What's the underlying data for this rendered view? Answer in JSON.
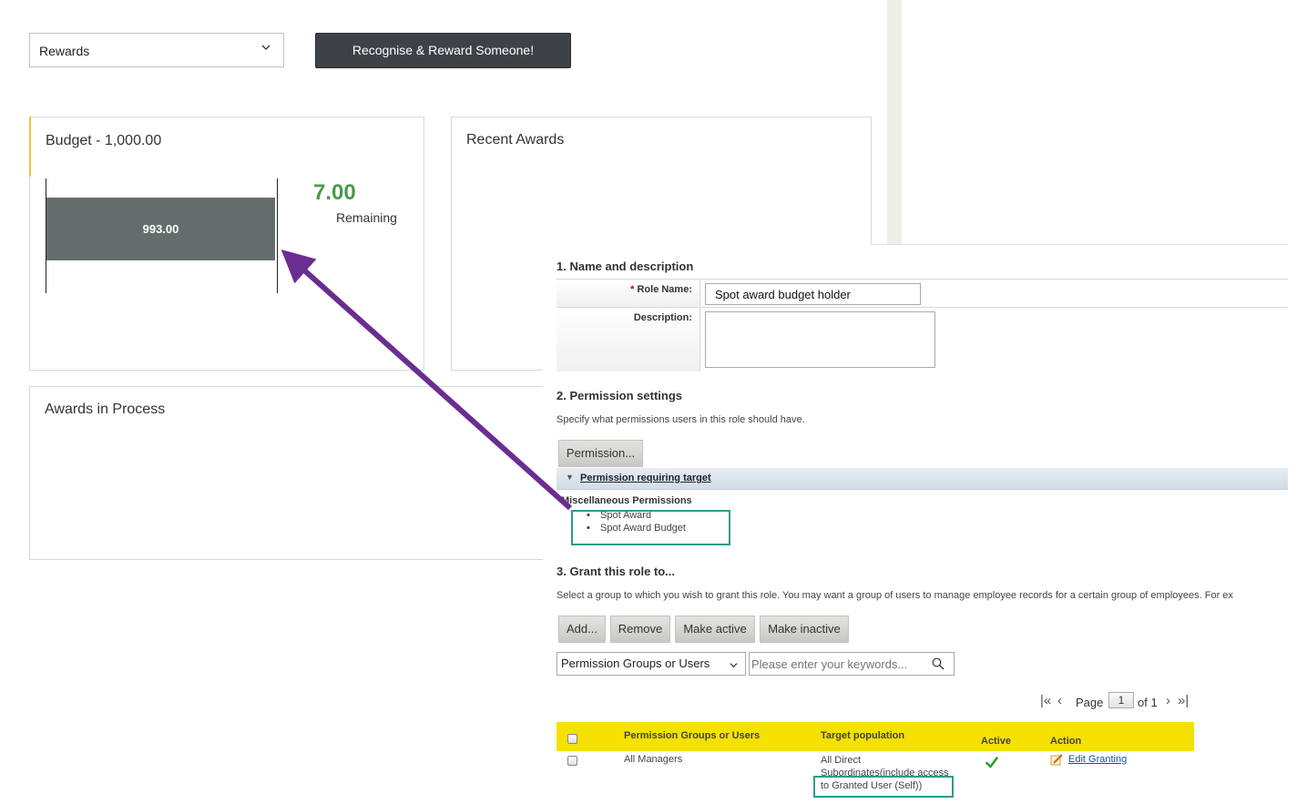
{
  "toolbar": {
    "rewards_select": "Rewards",
    "recognise_button": "Recognise & Reward Someone!"
  },
  "budget": {
    "title": "Budget - 1,000.00",
    "used_value": "993.00",
    "used_fraction": 0.993,
    "remaining_value": "7.00",
    "remaining_label": "Remaining"
  },
  "recent_awards": {
    "title": "Recent Awards"
  },
  "awards_in_process": {
    "title": "Awards in Process"
  },
  "role_form": {
    "section1_title": "1. Name and description",
    "role_name_label": "Role Name:",
    "role_name_value": "Spot award budget holder",
    "description_label": "Description:",
    "description_value": "",
    "section2_title": "2. Permission settings",
    "section2_desc": "Specify what permissions users in this role should have.",
    "permission_button": "Permission...",
    "permission_target_label": "Permission requiring target",
    "misc_title": "Miscellaneous Permissions",
    "permissions": [
      "Spot Award",
      "Spot Award Budget"
    ],
    "section3_title": "3. Grant this role to...",
    "section3_desc": "Select a group to which you wish to grant this role. You may want a group of users to manage employee records for a certain group of employees. For ex",
    "buttons": {
      "add": "Add...",
      "remove": "Remove",
      "make_active": "Make active",
      "make_inactive": "Make inactive"
    },
    "filter_select": "Permission Groups or Users",
    "search_placeholder": "Please enter your keywords...",
    "pager": {
      "page_label": "Page",
      "page_number": "1",
      "of_label": "of 1"
    },
    "table": {
      "headers": [
        "Permission Groups or Users",
        "Target population",
        "Active",
        "Action"
      ],
      "rows": [
        {
          "group": "All Managers",
          "target_line1": "All Direct",
          "target_line2": "Subordinates(include access",
          "target_line3": "to Granted User (Self))",
          "active": true,
          "action": "Edit Granting"
        }
      ]
    }
  },
  "colors": {
    "bar": "#646d6b",
    "remaining": "#4a9a4a",
    "arrow": "#6a2d91",
    "highlight_box": "#2e9c8a",
    "table_header": "#f5e100"
  }
}
